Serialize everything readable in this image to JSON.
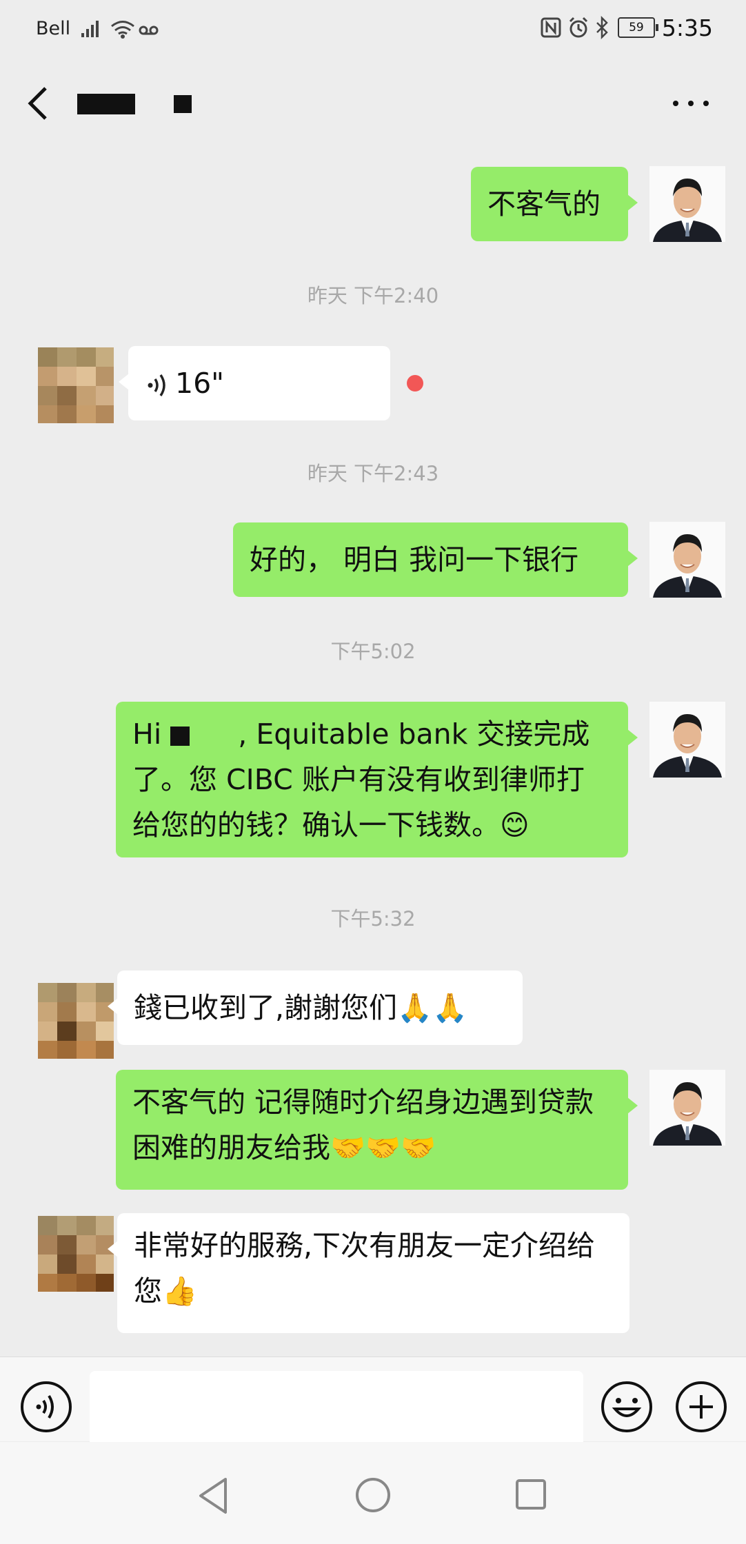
{
  "status_bar": {
    "carrier": "Bell",
    "battery": "59",
    "time": "5:35"
  },
  "header": {
    "icons": [
      "back-icon",
      "more-icon"
    ]
  },
  "messages": [
    {
      "type": "text",
      "side": "right",
      "text": "不客气的"
    },
    {
      "type": "timestamp",
      "text": "昨天 下午2:40"
    },
    {
      "type": "voice",
      "side": "left",
      "duration": "16\"",
      "unread": true
    },
    {
      "type": "timestamp",
      "text": "昨天 下午2:43"
    },
    {
      "type": "text",
      "side": "right",
      "text": "好的， 明白 我问一下银行"
    },
    {
      "type": "timestamp",
      "text": "下午5:02"
    },
    {
      "type": "text",
      "side": "right",
      "text_parts": [
        "Hi ",
        ", Equitable bank 交接完成了。您 CIBC 账户有没有收到律师打给您的的钱？确认一下钱数。",
        "😊"
      ]
    },
    {
      "type": "timestamp",
      "text": "下午5:32"
    },
    {
      "type": "text",
      "side": "left",
      "text_parts": [
        "錢已收到了,謝謝您们",
        "🙏🙏"
      ]
    },
    {
      "type": "text",
      "side": "right",
      "text_parts": [
        "不客气的 记得随时介绍身边遇到贷款困难的朋友给我",
        "🤝🤝🤝"
      ]
    },
    {
      "type": "text",
      "side": "left",
      "text_parts": [
        "非常好的服務,下次有朋友一定介绍给您",
        "👍"
      ]
    }
  ],
  "input_bar": {
    "value": "",
    "icons": [
      "voice-icon",
      "emoji-icon",
      "plus-icon"
    ]
  },
  "system_nav": {
    "icons": [
      "nav-back-icon",
      "nav-home-icon",
      "nav-recents-icon"
    ]
  },
  "colors": {
    "background": "#ededed",
    "sent_bubble": "#95ec69",
    "received_bubble": "#ffffff",
    "unread_dot": "#f25756",
    "timestamp_text": "#a8a8a8"
  }
}
